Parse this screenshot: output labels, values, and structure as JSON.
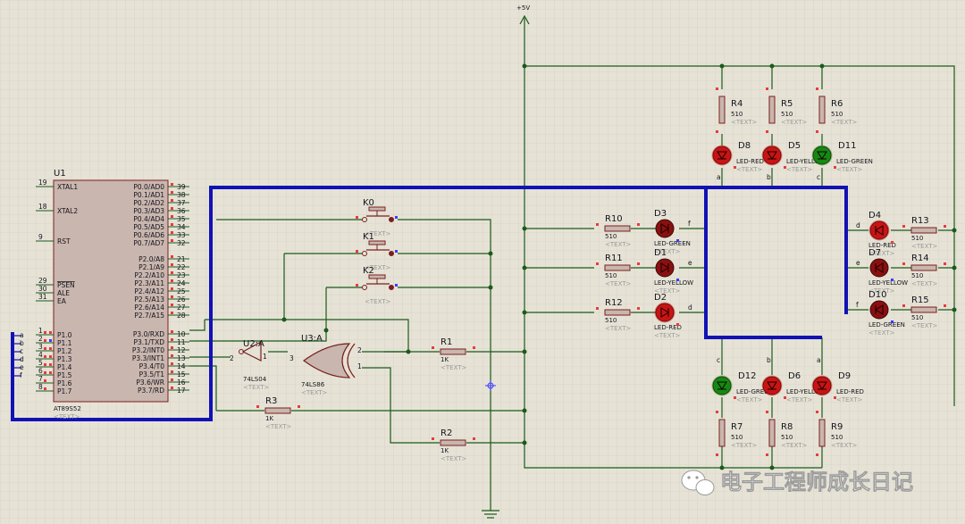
{
  "supply": {
    "label": "+5V"
  },
  "mcu": {
    "ref": "U1",
    "part": "AT89S52",
    "text_placeholder": "<TEXT>",
    "left_pins": [
      {
        "num": "19",
        "name": "XTAL1"
      },
      {
        "num": "18",
        "name": "XTAL2"
      },
      {
        "num": "9",
        "name": "RST"
      },
      {
        "num": "29",
        "name": "PSEN"
      },
      {
        "num": "30",
        "name": "ALE"
      },
      {
        "num": "31",
        "name": "EA"
      },
      {
        "num": "1",
        "name": "P1.0"
      },
      {
        "num": "2",
        "name": "P1.1"
      },
      {
        "num": "3",
        "name": "P1.2"
      },
      {
        "num": "4",
        "name": "P1.3"
      },
      {
        "num": "5",
        "name": "P1.4"
      },
      {
        "num": "6",
        "name": "P1.5"
      },
      {
        "num": "7",
        "name": "P1.6"
      },
      {
        "num": "8",
        "name": "P1.7"
      }
    ],
    "bus_letters": [
      "a",
      "b",
      "c",
      "d",
      "e",
      "f"
    ],
    "right_pins": [
      {
        "num": "39",
        "name": "P0.0/AD0"
      },
      {
        "num": "38",
        "name": "P0.1/AD1"
      },
      {
        "num": "37",
        "name": "P0.2/AD2"
      },
      {
        "num": "36",
        "name": "P0.3/AD3"
      },
      {
        "num": "35",
        "name": "P0.4/AD4"
      },
      {
        "num": "34",
        "name": "P0.5/AD5"
      },
      {
        "num": "33",
        "name": "P0.6/AD6"
      },
      {
        "num": "32",
        "name": "P0.7/AD7"
      },
      {
        "num": "21",
        "name": "P2.0/A8"
      },
      {
        "num": "22",
        "name": "P2.1/A9"
      },
      {
        "num": "23",
        "name": "P2.2/A10"
      },
      {
        "num": "24",
        "name": "P2.3/A11"
      },
      {
        "num": "25",
        "name": "P2.4/A12"
      },
      {
        "num": "26",
        "name": "P2.5/A13"
      },
      {
        "num": "27",
        "name": "P2.6/A14"
      },
      {
        "num": "28",
        "name": "P2.7/A15"
      },
      {
        "num": "10",
        "name": "P3.0/RXD"
      },
      {
        "num": "11",
        "name": "P3.1/TXD"
      },
      {
        "num": "12",
        "name": "P3.2/INT0"
      },
      {
        "num": "13",
        "name": "P3.3/INT1"
      },
      {
        "num": "14",
        "name": "P3.4/T0"
      },
      {
        "num": "15",
        "name": "P3.5/T1"
      },
      {
        "num": "16",
        "name": "P3.6/WR"
      },
      {
        "num": "17",
        "name": "P3.7/RD"
      }
    ]
  },
  "switches": [
    {
      "ref": "K0"
    },
    {
      "ref": "K1"
    },
    {
      "ref": "K2"
    }
  ],
  "inverter": {
    "ref": "U2:A",
    "part": "74LS04",
    "pin_in": "1",
    "pin_out": "2"
  },
  "xor": {
    "ref": "U3:A",
    "part": "74LS86",
    "pin_a": "1",
    "pin_b": "2",
    "pin_out": "3"
  },
  "resistors": [
    {
      "ref": "R1",
      "value": "1K"
    },
    {
      "ref": "R2",
      "value": "1K"
    },
    {
      "ref": "R3",
      "value": "1K"
    },
    {
      "ref": "R4",
      "value": "510"
    },
    {
      "ref": "R5",
      "value": "510"
    },
    {
      "ref": "R6",
      "value": "510"
    },
    {
      "ref": "R7",
      "value": "510"
    },
    {
      "ref": "R8",
      "value": "510"
    },
    {
      "ref": "R9",
      "value": "510"
    },
    {
      "ref": "R10",
      "value": "510"
    },
    {
      "ref": "R11",
      "value": "510"
    },
    {
      "ref": "R12",
      "value": "510"
    },
    {
      "ref": "R13",
      "value": "510"
    },
    {
      "ref": "R14",
      "value": "510"
    },
    {
      "ref": "R15",
      "value": "510"
    }
  ],
  "leds": [
    {
      "ref": "D8",
      "part": "LED-RED",
      "color": "#c81414",
      "lit": true,
      "net": "a"
    },
    {
      "ref": "D5",
      "part": "LED-YELLOW",
      "color": "#c81414",
      "lit": true,
      "net": "b"
    },
    {
      "ref": "D11",
      "part": "LED-GREEN",
      "color": "#138a13",
      "lit": true,
      "net": "c"
    },
    {
      "ref": "D3",
      "part": "LED-GREEN",
      "color": "#8a1010",
      "lit": false,
      "net": "f"
    },
    {
      "ref": "D1",
      "part": "LED-YELLOW",
      "color": "#8a1010",
      "lit": false,
      "net": "e"
    },
    {
      "ref": "D2",
      "part": "LED-RED",
      "color": "#c81414",
      "lit": true,
      "net": "d"
    },
    {
      "ref": "D4",
      "part": "LED-RED",
      "color": "#c81414",
      "lit": true,
      "net": "d"
    },
    {
      "ref": "D7",
      "part": "LED-YELLOW",
      "color": "#8a1010",
      "lit": false,
      "net": "e"
    },
    {
      "ref": "D10",
      "part": "LED-GREEN",
      "color": "#8a1010",
      "lit": false,
      "net": "f"
    },
    {
      "ref": "D12",
      "part": "LED-GREEN",
      "color": "#138a13",
      "lit": true,
      "net": "c"
    },
    {
      "ref": "D6",
      "part": "LED-YELLOW",
      "color": "#c81414",
      "lit": true,
      "net": "b"
    },
    {
      "ref": "D9",
      "part": "LED-RED",
      "color": "#c81414",
      "lit": true,
      "net": "a"
    }
  ],
  "colors": {
    "background": "#e6e3d6",
    "grid": "#cfccbe",
    "wire": "#1b5a1b",
    "bus": "#1212b4",
    "body": "#c9b6ae",
    "outline": "#7a1f1f",
    "pin_red": "#e63c3c",
    "pin_blue": "#3c3cff"
  },
  "watermark": {
    "text": "电子工程师成长日记",
    "icon": "wechat-icon"
  }
}
